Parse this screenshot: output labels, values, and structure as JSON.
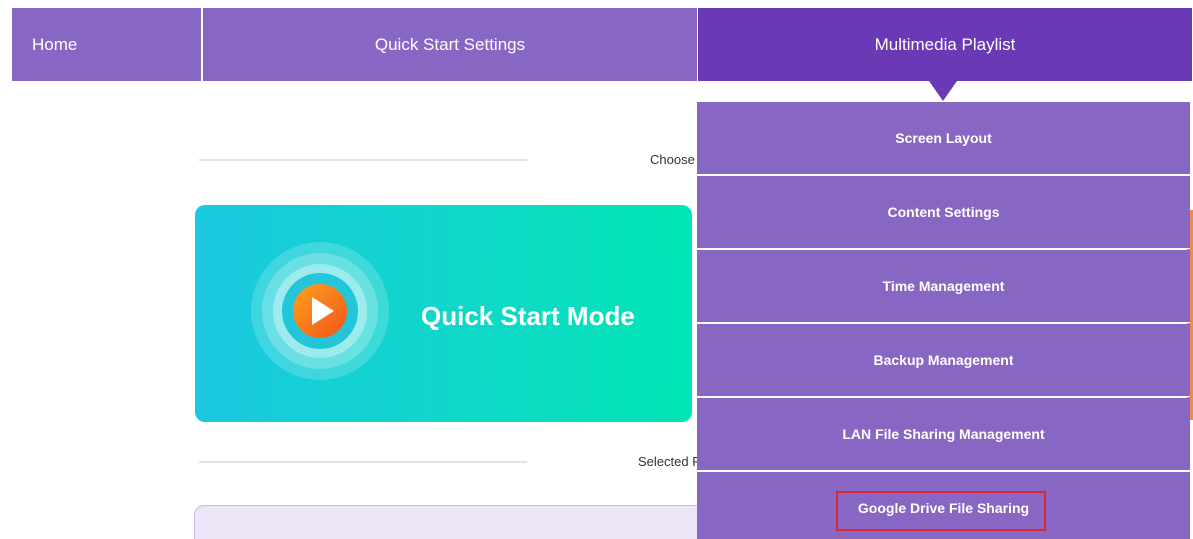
{
  "nav": {
    "home": "Home",
    "quick_start": "Quick Start Settings",
    "multimedia": "Multimedia Playlist"
  },
  "sections": {
    "choose_caption": "Choose",
    "selected_caption": "Selected P"
  },
  "quick_start_card": {
    "title": "Quick Start Mode",
    "icon": "play-icon"
  },
  "dropdown": {
    "items": [
      {
        "label": "Screen Layout"
      },
      {
        "label": "Content Settings"
      },
      {
        "label": "Time Management"
      },
      {
        "label": "Backup Management"
      },
      {
        "label": "LAN File Sharing Management"
      },
      {
        "label": "Google Drive File Sharing",
        "highlighted": true
      }
    ]
  },
  "colors": {
    "nav": "#8866c4",
    "nav_active": "#6939b6",
    "card_gradient_start": "#1ac8e0",
    "card_gradient_end": "#00e6b4",
    "highlight_border": "#e0262b",
    "play_orange": "#f5821f"
  }
}
